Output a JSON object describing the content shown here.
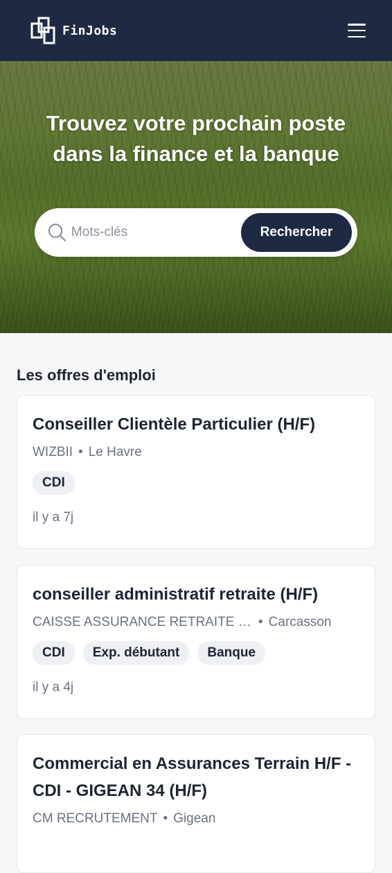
{
  "header": {
    "brand": "FinJobs",
    "logo_icon": "finjobs-logo-icon",
    "menu_icon": "hamburger-menu-icon"
  },
  "hero": {
    "title": "Trouvez votre prochain poste dans la finance et la banque",
    "search": {
      "placeholder": "Mots-clés",
      "value": "",
      "button_label": "Rechercher",
      "icon": "search-icon"
    }
  },
  "jobs": {
    "section_title": "Les offres d'emploi",
    "items": [
      {
        "title": "Conseiller Clientèle Particulier (H/F)",
        "company": "WIZBII",
        "location": "Le Havre",
        "tags": [
          "CDI"
        ],
        "posted": "il y a 7j"
      },
      {
        "title": "conseiller administratif retraite (H/F)",
        "company": "CAISSE ASSURANCE RETRAITE ET...",
        "location": "Carcasson",
        "tags": [
          "CDI",
          "Exp. débutant",
          "Banque"
        ],
        "posted": "il y a 4j"
      },
      {
        "title": "Commercial en Assurances Terrain H/F - CDI - GIGEAN 34 (H/F)",
        "company": "CM RECRUTEMENT",
        "location": "Gigean",
        "tags": [],
        "posted": ""
      }
    ]
  },
  "colors": {
    "navy": "#1e2a44",
    "tag_bg": "#eef0f4",
    "muted_text": "#6b7180"
  }
}
